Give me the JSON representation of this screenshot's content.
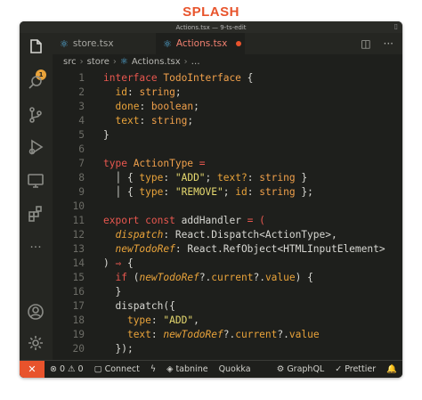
{
  "brand": "SPLASH",
  "window": {
    "title": "Actions.tsx — 9-ts-edit"
  },
  "activity": {
    "badge": "1"
  },
  "tabs": [
    {
      "label": "store.tsx",
      "active": false
    },
    {
      "label": "Actions.tsx",
      "active": true
    }
  ],
  "breadcrumb": {
    "part1": "src",
    "part2": "store",
    "part3": "Actions.tsx",
    "part4": "…"
  },
  "code": {
    "n": [
      "1",
      "2",
      "3",
      "4",
      "5",
      "6",
      "7",
      "8",
      "9",
      "10",
      "11",
      "12",
      "13",
      "14",
      "15",
      "16",
      "17",
      "18",
      "19",
      "20"
    ],
    "l1a": "interface ",
    "l1b": "TodoInterface",
    "l1c": " {",
    "l2a": "  ",
    "l2b": "id",
    "l2c": ": ",
    "l2d": "string",
    "l2e": ";",
    "l3b": "done",
    "l3d": "boolean",
    "l4b": "text",
    "l4d": "string",
    "l5": "}",
    "l7a": "type ",
    "l7b": "ActionType",
    "l7c": " =",
    "l8a": "  │ { ",
    "l8b": "type",
    "l8c": ": ",
    "l8d": "\"ADD\"",
    "l8e": "; ",
    "l8f": "text?",
    "l8g": ": ",
    "l8h": "string",
    "l8i": " }",
    "l9a": "  │ { ",
    "l9b": "type",
    "l9c": ": ",
    "l9d": "\"REMOVE\"",
    "l9e": "; ",
    "l9f": "id",
    "l9g": ": ",
    "l9h": "string",
    "l9i": " };",
    "l11a": "export ",
    "l11b": "const ",
    "l11c": "addHandler",
    "l11d": " = (",
    "l12a": "  ",
    "l12b": "dispatch",
    "l12c": ": ",
    "l12d": "React.Dispatch<ActionType>",
    "l12e": ",",
    "l13b": "newTodoRef",
    "l13d": "React.RefObject<HTMLInputElement>",
    "l14a": ") ",
    "l14b": "⇒",
    "l14c": " {",
    "l15a": "  ",
    "l15b": "if",
    "l15c": " (",
    "l15d": "newTodoRef",
    "l15e": "?.",
    "l15f": "current",
    "l15g": "?.",
    "l15h": "value",
    "l15i": ") {",
    "l16": "  }",
    "l17a": "  ",
    "l17b": "dispatch",
    "l17c": "({",
    "l18a": "    ",
    "l18b": "type",
    "l18c": ": ",
    "l18d": "\"ADD\"",
    "l18e": ",",
    "l19a": "    ",
    "l19b": "text",
    "l19c": ": ",
    "l19d": "newTodoRef",
    "l19e": "?.",
    "l19f": "current",
    "l19g": "?.",
    "l19h": "value",
    "l20": "  });"
  },
  "status": {
    "errors": "0",
    "warnings": "0",
    "connect": "Connect",
    "tabnine": "tabnine",
    "quokka": "Quokka",
    "graphql": "GraphQL",
    "prettier": "Prettier"
  },
  "colors": {
    "accent": "#e8532c",
    "brand": "#e8542c",
    "badge": "#e9a33a"
  }
}
